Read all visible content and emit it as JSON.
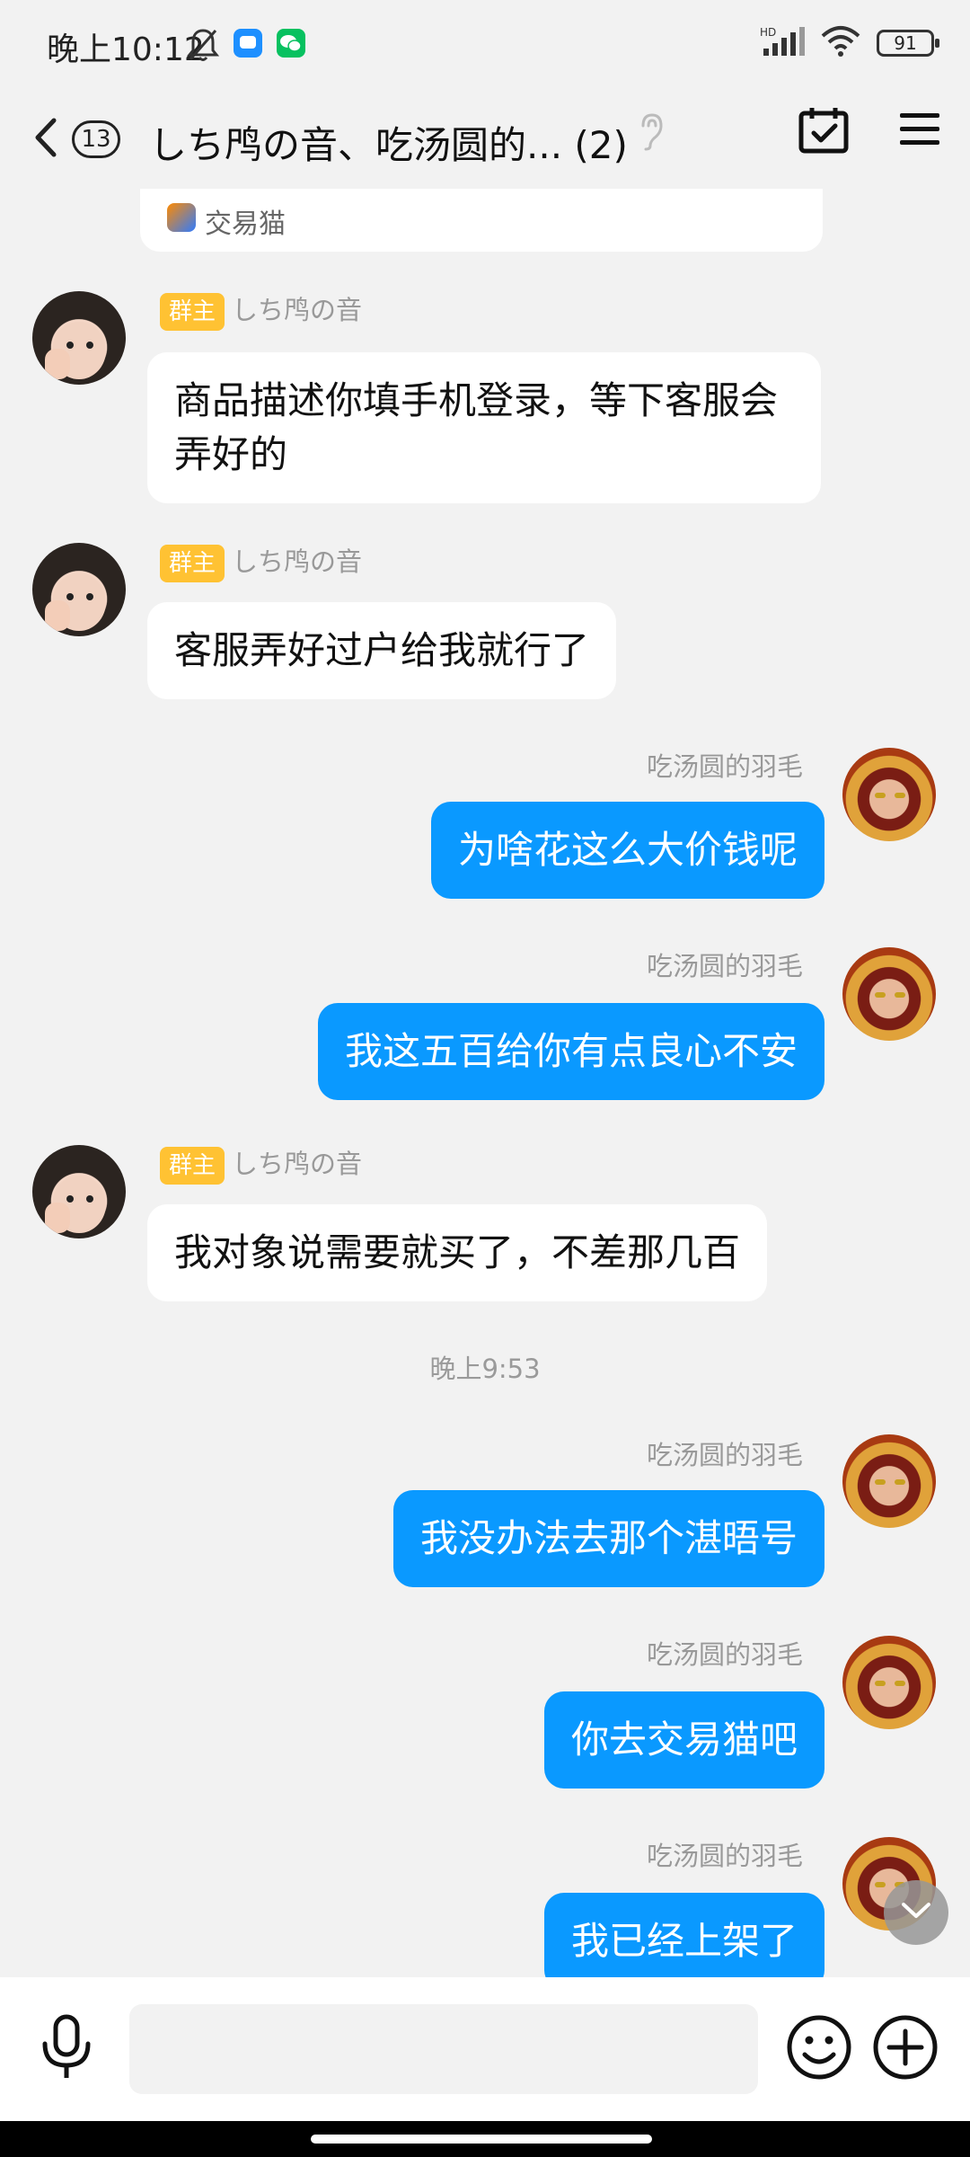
{
  "status_bar": {
    "time": "晚上10:12",
    "network_label": "HD",
    "battery": "91"
  },
  "header": {
    "unread_count": "13",
    "title": "しち鸤の音、吃汤圆的... (2)"
  },
  "reference_card": {
    "text": "交易猫"
  },
  "messages": [
    {
      "side": "left",
      "badge": "群主",
      "sender": "しち鸤の音",
      "text": "商品描述你填手机登录，等下客服会弄好的"
    },
    {
      "side": "left",
      "badge": "群主",
      "sender": "しち鸤の音",
      "text": "客服弄好过户给我就行了"
    },
    {
      "side": "right",
      "sender": "吃汤圆的羽毛",
      "text": "为啥花这么大价钱呢"
    },
    {
      "side": "right",
      "sender": "吃汤圆的羽毛",
      "text": "我这五百给你有点良心不安"
    },
    {
      "side": "left",
      "badge": "群主",
      "sender": "しち鸤の音",
      "text": "我对象说需要就买了，不差那几百"
    },
    {
      "side": "right",
      "sender": "吃汤圆的羽毛",
      "text": "我没办法去那个湛晤号"
    },
    {
      "side": "right",
      "sender": "吃汤圆的羽毛",
      "text": "你去交易猫吧"
    },
    {
      "side": "right",
      "sender": "吃汤圆的羽毛",
      "text": "我已经上架了"
    }
  ],
  "timestamp": "晚上9:53",
  "input": {
    "value": "",
    "placeholder": ""
  },
  "colors": {
    "accent_bubble": "#0a99ff",
    "owner_badge": "#ffc233",
    "background": "#f2f2f2"
  },
  "icons": [
    "bell-off-icon",
    "app-notification-icon",
    "wechat-icon",
    "signal-icon",
    "wifi-icon",
    "battery-icon",
    "back-icon",
    "ear-icon",
    "calendar-check-icon",
    "menu-icon",
    "microphone-icon",
    "emoji-icon",
    "plus-icon",
    "chevron-down-icon"
  ]
}
